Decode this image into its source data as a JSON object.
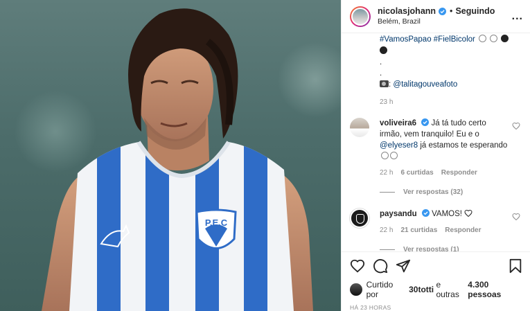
{
  "post": {
    "author": {
      "username": "nicolasjohann",
      "separator": "•",
      "follow_state": "Seguindo",
      "location": "Belém, Brazil",
      "more_menu": "..."
    },
    "caption": {
      "hashtags": "#VamosPapao #FielBicolor",
      "dot_lines": [
        ".",
        "."
      ],
      "photo_credit": "@talitagouveafoto",
      "time": "23 h"
    },
    "comments": [
      {
        "username": "voliveira6",
        "text_1": "Já tá tudo certo irmão, vem tranquilo! Eu e o ",
        "mention": "@elyeser8",
        "text_2": " já estamos te esperando",
        "time": "22 h",
        "likes": "6 curtidas",
        "reply_label": "Responder",
        "view_replies": "Ver respostas (32)"
      },
      {
        "username": "paysandu",
        "text_1": "VAMOS! ",
        "time": "22 h",
        "likes": "21 curtidas",
        "reply_label": "Responder",
        "view_replies": "Ver respostas (1)"
      }
    ],
    "footer": {
      "liked_by_prefix": "Curtido por ",
      "liked_by_user": "30totti",
      "liked_by_mid": " e outras ",
      "liked_by_count": "4.300 pessoas",
      "time_ago": "HÁ 23 HORAS"
    },
    "jersey_crest": "P.E.C"
  },
  "colors": {
    "link": "#00376b",
    "verified": "#3897f0",
    "jersey_blue": "#2f6cc7",
    "muted": "#8e8e8e"
  },
  "icons": [
    "verified-badge-icon",
    "more-icon",
    "heart-icon",
    "comment-icon",
    "share-icon",
    "bookmark-icon",
    "camera-emoji-icon"
  ]
}
